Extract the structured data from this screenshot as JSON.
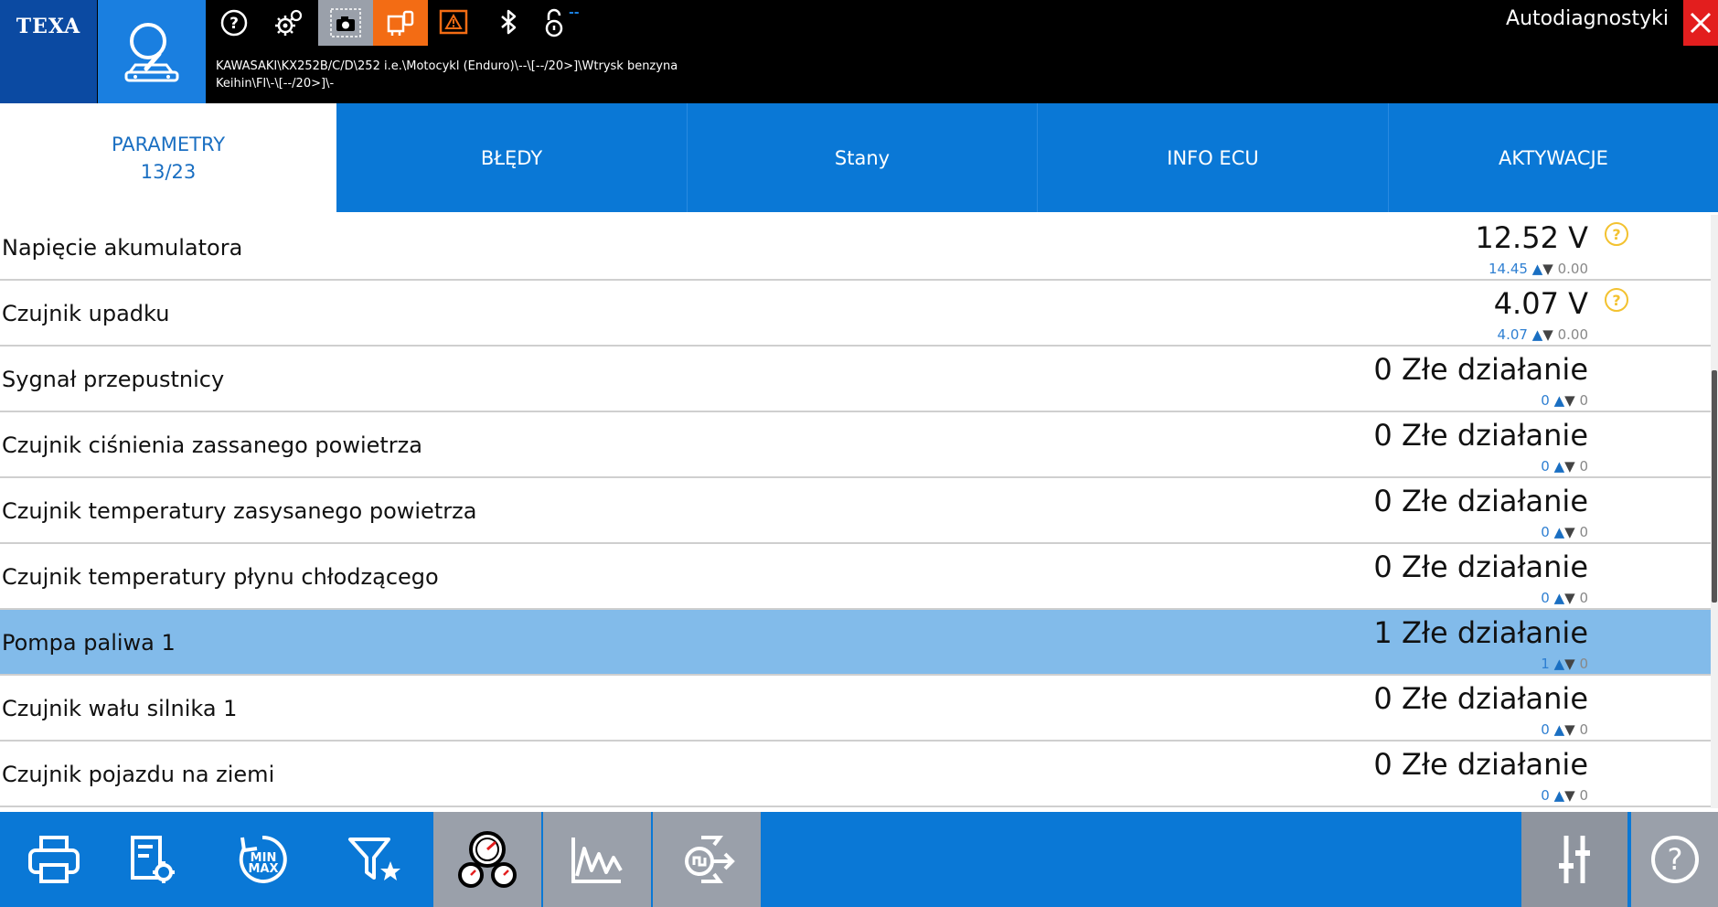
{
  "header": {
    "brand": "TEXA",
    "app_title": "Autodiagnostyki",
    "status_tiny": "--",
    "vehicle_path_line1": "KAWASAKI\\KX252B/C/D\\252 i.e.\\Motocykl (Enduro)\\--\\[--/20>]\\Wtrysk benzyna",
    "vehicle_path_line2": "Keihin\\FI\\-\\[--/20>]\\-",
    "icons": [
      "search-car-icon",
      "help-icon",
      "settings-icon",
      "camera-icon",
      "device-link-icon",
      "warning-icon",
      "bluetooth-icon",
      "lock-icon",
      "close-icon"
    ]
  },
  "tabs": [
    {
      "label": "PARAMETRY",
      "sub": "13/23",
      "active": true
    },
    {
      "label": "BŁĘDY"
    },
    {
      "label": "Stany"
    },
    {
      "label": "INFO ECU"
    },
    {
      "label": "AKTYWACJE"
    }
  ],
  "parameters": [
    {
      "name": "Napięcie akumulatora",
      "value": "12.52 V",
      "max": "14.45",
      "min": "0.00",
      "help": "?"
    },
    {
      "name": "Czujnik upadku",
      "value": "4.07 V",
      "max": "4.07",
      "min": "0.00",
      "help": "?"
    },
    {
      "name": "Sygnał przepustnicy",
      "value": "0 Złe działanie",
      "max": "0",
      "min": "0"
    },
    {
      "name": "Czujnik ciśnienia zassanego powietrza",
      "value": "0 Złe działanie",
      "max": "0",
      "min": "0"
    },
    {
      "name": "Czujnik temperatury zasysanego powietrza",
      "value": "0 Złe działanie",
      "max": "0",
      "min": "0"
    },
    {
      "name": "Czujnik temperatury płynu chłodzącego",
      "value": "0 Złe działanie",
      "max": "0",
      "min": "0"
    },
    {
      "name": "Pompa paliwa 1",
      "value": "1 Złe działanie",
      "max": "1",
      "min": "0",
      "selected": true
    },
    {
      "name": "Czujnik wału silnika 1",
      "value": "0 Złe działanie",
      "max": "0",
      "min": "0"
    },
    {
      "name": "Czujnik pojazdu na ziemi",
      "value": "0 Złe działanie",
      "max": "0",
      "min": "0"
    }
  ],
  "bottom_toolbar": {
    "minmax_label_top": "MIN",
    "minmax_label_bottom": "MAX",
    "icons": [
      "print-icon",
      "config-icon",
      "min-max-reset-icon",
      "filter-favorites-icon",
      "gauges-icon",
      "graph-icon",
      "signal-export-icon",
      "sliders-icon",
      "help-icon"
    ]
  },
  "colors": {
    "primary_blue": "#0a78d6",
    "tile_blue": "#1a7fe0",
    "brand_blue": "#0b4aa2",
    "selected_row": "#82bbea",
    "orange": "#f36c14",
    "close_red": "#e31e1e",
    "help_yellow": "#f3c230"
  }
}
